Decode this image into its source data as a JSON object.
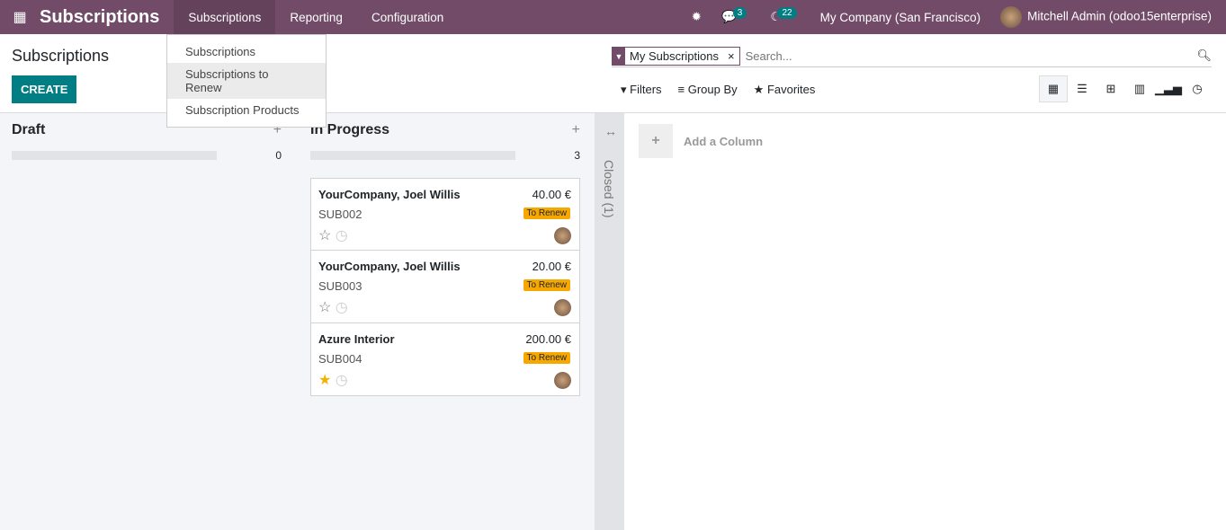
{
  "nav": {
    "app": "Subscriptions",
    "menus": [
      "Subscriptions",
      "Reporting",
      "Configuration"
    ],
    "messages_count": "3",
    "activities_count": "22",
    "company": "My Company (San Francisco)",
    "user": "Mitchell Admin (odoo15enterprise)"
  },
  "dropdown": [
    "Subscriptions",
    "Subscriptions to Renew",
    "Subscription Products"
  ],
  "page": {
    "title": "Subscriptions",
    "create": "CREATE"
  },
  "search": {
    "facet": "My Subscriptions",
    "placeholder": "Search..."
  },
  "filters": {
    "filters": "Filters",
    "group_by": "Group By",
    "favorites": "Favorites"
  },
  "columns": [
    {
      "name": "Draft",
      "count": "0",
      "cards": []
    },
    {
      "name": "In Progress",
      "count": "3",
      "cards": [
        {
          "name": "YourCompany, Joel Willis",
          "amount": "40.00 €",
          "ref": "SUB002",
          "tag": "To Renew",
          "starred": false
        },
        {
          "name": "YourCompany, Joel Willis",
          "amount": "20.00 €",
          "ref": "SUB003",
          "tag": "To Renew",
          "starred": false
        },
        {
          "name": "Azure Interior",
          "amount": "200.00 €",
          "ref": "SUB004",
          "tag": "To Renew",
          "starred": true
        }
      ]
    }
  ],
  "closed": "Closed (1)",
  "add_column": "Add a Column",
  "colors": {
    "brand": "#714b67",
    "accent": "#017e84",
    "tag": "#f6a800"
  }
}
